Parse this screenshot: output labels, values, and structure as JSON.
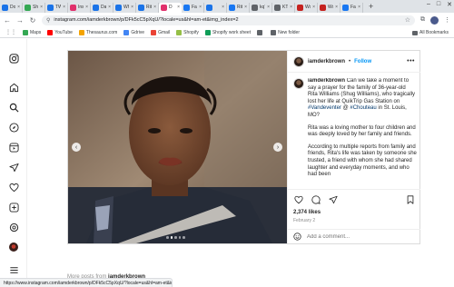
{
  "browser": {
    "tabs": [
      {
        "label": "Docu",
        "color": "#1a73e8",
        "active": false
      },
      {
        "label": "Sh",
        "color": "#34a853",
        "active": false
      },
      {
        "label": "TWK",
        "color": "#1a73e8",
        "active": false
      },
      {
        "label": "Inst",
        "color": "#e1306c",
        "active": false
      },
      {
        "label": "Dark",
        "color": "#1a73e8",
        "active": false
      },
      {
        "label": "Wha",
        "color": "#1a73e8",
        "active": false
      },
      {
        "label": "Rita",
        "color": "#1a73e8",
        "active": false
      },
      {
        "label": "D",
        "color": "#e1306c",
        "active": true
      },
      {
        "label": "Farah",
        "color": "#1877f2",
        "active": false
      },
      {
        "label": "",
        "color": "#1a73e8",
        "active": false
      },
      {
        "label": "Rita",
        "color": "#1877f2",
        "active": false
      },
      {
        "label": "kqTG",
        "color": "#5f6368",
        "active": false
      },
      {
        "label": "KTRI",
        "color": "#5f6368",
        "active": false
      },
      {
        "label": "Wom",
        "color": "#c5221f",
        "active": false
      },
      {
        "label": "Wom",
        "color": "#c5221f",
        "active": false
      },
      {
        "label": "Farah",
        "color": "#1877f2",
        "active": false
      }
    ],
    "new_tab": "+",
    "url": "instagram.com/iamderkbrown/p/DFk5cC5pXqU/?locale=us&hl=am-et&img_index=2",
    "bookmarks": [
      {
        "label": "Maps",
        "color": "#34a853"
      },
      {
        "label": "YouTube",
        "color": "#ff0000"
      },
      {
        "label": "Thesaurus.com",
        "color": "#f4a300"
      },
      {
        "label": "Gdrive",
        "color": "#4285f4"
      },
      {
        "label": "Gmail",
        "color": "#ea4335"
      },
      {
        "label": "Shopify",
        "color": "#95bf47"
      },
      {
        "label": "Shopify work sheet",
        "color": "#0f9d58"
      },
      {
        "label": "",
        "color": "#5f6368"
      },
      {
        "label": "New folder",
        "color": "#5f6368"
      }
    ],
    "all_bookmarks": "All Bookmarks",
    "status_url": "https://www.instagram.com/iamderkbrown/p/DFk5cC5pXqU/?locale=us&hl=am-et&img_index=2"
  },
  "post": {
    "username": "iamderkbrown",
    "separator": "•",
    "follow_label": "Follow",
    "more_label": "•••",
    "caption": {
      "user": "iamderkbrown",
      "p1_a": "Can we take a moment to say a prayer for the family of 36-year-old Rita Williams (Shug Williams), who tragically lost her life at QuikTrip Gas Station on ",
      "tag1": "#Vandeventer",
      "p1_b": " @ ",
      "tag2": "#Chouteau",
      "p1_c": " in St. Louis, MO?",
      "p2": "Rita was a loving mother to four children and was deeply loved by her family and friends.",
      "p3": "According to multiple reports from family and friends, Rita's life was taken by someone she trusted, a friend with whom she had shared laughter and everyday moments, and who had been"
    },
    "likes": "2,374 likes",
    "date": "February 2",
    "comment_placeholder": "Add a comment...",
    "carousel": {
      "count": 5,
      "active_index": 1
    }
  },
  "more_posts": {
    "prefix": "More posts from",
    "user": "iamderkbrown"
  }
}
